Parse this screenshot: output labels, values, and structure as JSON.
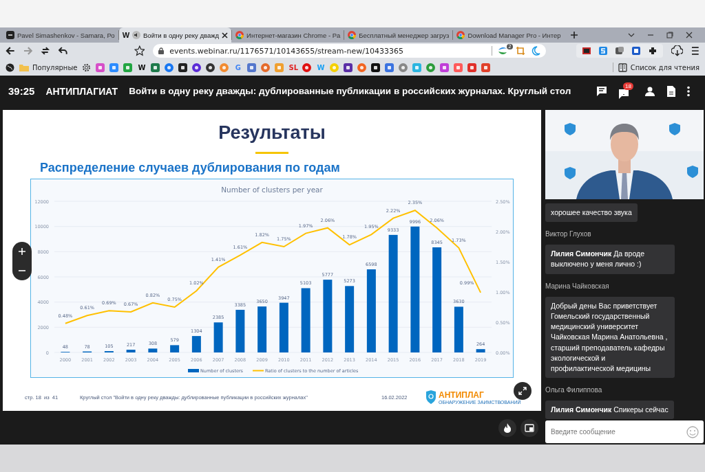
{
  "browser": {
    "tabs": [
      {
        "title": "Pavel Simashenkov - Samara, Ро",
        "selected": false,
        "kind": "app",
        "audio": false
      },
      {
        "title": "Войти в одну реку дважд",
        "selected": true,
        "kind": "letter",
        "favicon_text": "W",
        "audio": true
      },
      {
        "title": "Интернет-магазин Chrome - Pa",
        "selected": false,
        "kind": "chrome",
        "audio": false
      },
      {
        "title": "Бесплатный менеджер загруз",
        "selected": false,
        "kind": "chrome",
        "audio": false
      },
      {
        "title": "Download Manager Pro - Интер",
        "selected": false,
        "kind": "chrome",
        "audio": false
      }
    ],
    "address": {
      "url": "events.webinar.ru/1176571/10143655/stream-new/10433365"
    },
    "extension_badge": "2",
    "bookmarks": [
      {
        "kind": "globe"
      },
      {
        "kind": "folder",
        "label": "Популярные"
      },
      {
        "kind": "gear"
      },
      {
        "kind": "square",
        "color": "#d64fc8"
      },
      {
        "kind": "square",
        "color": "#2d8cff"
      },
      {
        "kind": "square",
        "color": "#22a542"
      },
      {
        "kind": "glyph",
        "text": "W",
        "color": "#111111"
      },
      {
        "kind": "square",
        "color": "#1e7a4b"
      },
      {
        "kind": "circle",
        "color": "#1877f2"
      },
      {
        "kind": "square",
        "color": "#222222"
      },
      {
        "kind": "circle",
        "color": "#5b2bd6"
      },
      {
        "kind": "circle",
        "color": "#333333"
      },
      {
        "kind": "circle",
        "color": "#f28b30"
      },
      {
        "kind": "glyph",
        "text": "G",
        "color": "#4285f4"
      },
      {
        "kind": "square",
        "color": "#5577cc"
      },
      {
        "kind": "circle",
        "color": "#e56a2a"
      },
      {
        "kind": "square",
        "color": "#f0a030"
      },
      {
        "kind": "glyph",
        "text": "SL",
        "color": "#e02020"
      },
      {
        "kind": "circle",
        "color": "#e01010"
      },
      {
        "kind": "glyph",
        "text": "W",
        "color": "#1da1f2"
      },
      {
        "kind": "circle",
        "color": "#f5d000"
      },
      {
        "kind": "square",
        "color": "#5a2ea6"
      },
      {
        "kind": "circle",
        "color": "#f26522"
      },
      {
        "kind": "square",
        "color": "#111111"
      },
      {
        "kind": "square",
        "color": "#3b73e0"
      },
      {
        "kind": "circle",
        "color": "#888888"
      },
      {
        "kind": "square",
        "color": "#2bb5e0"
      },
      {
        "kind": "circle",
        "color": "#2c9c3c"
      },
      {
        "kind": "square",
        "color": "#c03fd8"
      },
      {
        "kind": "square",
        "color": "#ff5a5a"
      },
      {
        "kind": "square",
        "color": "#e0302a"
      },
      {
        "kind": "square",
        "color": "#e0402a"
      }
    ],
    "reading_list": "Список для чтения"
  },
  "webinar": {
    "timer": "39:25",
    "brand": "АНТИПЛАГИАТ",
    "title": "Войти в одну реку дважды: дублированные публикации в российских журналах. Круглый стол",
    "questions_badge": "18"
  },
  "slide": {
    "title": "Результаты",
    "subtitle": "Распределение случаев дублирования по годам",
    "clusters_chart": {
      "chart_data": {
        "type": "bar",
        "title": "Number of clusters per year",
        "categories": [
          "2000",
          "2001",
          "2002",
          "2003",
          "2004",
          "2005",
          "2006",
          "2007",
          "2008",
          "2009",
          "2010",
          "2011",
          "2012",
          "2013",
          "2014",
          "2015",
          "2016",
          "2017",
          "2018",
          "2019"
        ],
        "series": [
          {
            "name": "Number of clusters",
            "color": "#0066bf",
            "values": [
              48,
              78,
              105,
              217,
              308,
              579,
              1304,
              2385,
              3385,
              3650,
              3947,
              5103,
              5777,
              5273,
              6598,
              9333,
              9996,
              8345,
              3630,
              264
            ]
          }
        ],
        "ylim": [
          0,
          12000
        ],
        "yticks": [
          0,
          2000,
          4000,
          6000,
          8000,
          10000,
          12000
        ],
        "grid": true,
        "data_labels": true
      }
    },
    "ratio_chart": {
      "chart_data": {
        "type": "line",
        "series": [
          {
            "name": "Ratio of clusters to the number of articles",
            "color": "#ffc000",
            "values": [
              0.48,
              0.61,
              0.69,
              0.67,
              0.82,
              0.75,
              1.02,
              1.41,
              1.61,
              1.82,
              1.75,
              1.97,
              2.06,
              1.78,
              1.95,
              2.22,
              2.35,
              2.06,
              1.73,
              0.99
            ]
          }
        ],
        "ylim": [
          0,
          2.5
        ],
        "yticks": [
          {
            "value": 0,
            "label": "0.00%"
          },
          {
            "value": 0.5,
            "label": "0.50%"
          },
          {
            "value": 1,
            "label": "1.00%"
          },
          {
            "value": 1.5,
            "label": "1.50%"
          },
          {
            "value": 2,
            "label": "2.00%"
          },
          {
            "value": 2.5,
            "label": "2.50%"
          }
        ],
        "value_labels": [
          "0.48%",
          "0.61%",
          "0.69%",
          "0.67%",
          "0.82%",
          "0.75%",
          "1.02%",
          "1.41%",
          "1.61%",
          "1.82%",
          "1.75%",
          "1.97%",
          "2.06%",
          "1.78%",
          "1.95%",
          "2.22%",
          "2.35%",
          "2.06%",
          "1.73%",
          "0.99%"
        ]
      }
    },
    "footer": {
      "page": "стр. 18  из  41",
      "caption": "Круглый стол \"Войти в одну реку дважды: дублированные публикации в российских журналах\"",
      "date": "16.02.2022",
      "logo": "АНТИПЛАГ",
      "logo_sub": "ОБНАРУЖЕНИЕ ЗАИМСТВОВАНИЙ"
    }
  },
  "chat": {
    "messages": [
      {
        "text": "хорошее качество звука"
      },
      {
        "author": "Виктор Глухов",
        "text": "**Лилия Симончик**  Да вроде выключено у меня лично :)"
      },
      {
        "author": "Марина Чайковская",
        "text": "Добрый дены Вас приветствует Гомельский государственный медицинский университет Чайковская Марина Анатольевна , старший преподаватель  кафедры экологической и профилактической медицины"
      },
      {
        "author": "Ольга Филиппова",
        "text": "**Лилия Симончик** Спикеры сейчас"
      }
    ],
    "input_placeholder": "Введите сообщение"
  }
}
